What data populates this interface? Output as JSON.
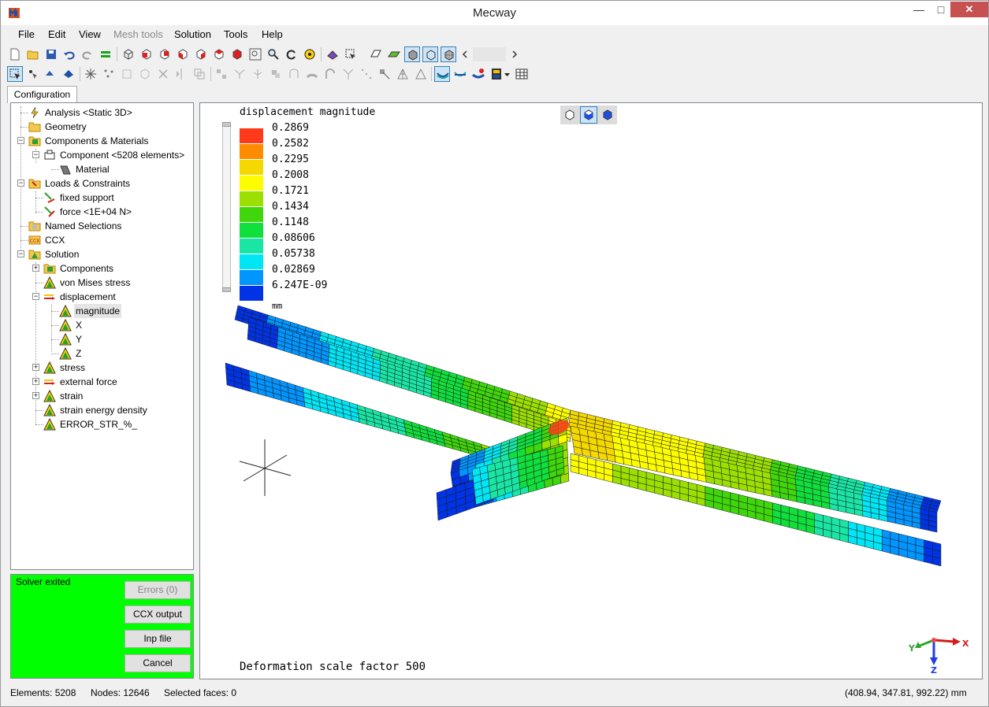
{
  "window": {
    "title": "Mecway"
  },
  "menu": [
    {
      "label": "File",
      "enabled": true
    },
    {
      "label": "Edit",
      "enabled": true
    },
    {
      "label": "View",
      "enabled": true
    },
    {
      "label": "Mesh tools",
      "enabled": false
    },
    {
      "label": "Solution",
      "enabled": true
    },
    {
      "label": "Tools",
      "enabled": true
    },
    {
      "label": "Help",
      "enabled": true
    }
  ],
  "tabs": [
    {
      "label": "Configuration",
      "active": true
    }
  ],
  "tree": {
    "analysis": "Analysis <Static 3D>",
    "geometry": "Geometry",
    "components_materials": "Components & Materials",
    "component": "Component <5208 elements>",
    "material": "Material",
    "loads_constraints": "Loads & Constraints",
    "fixed_support": "fixed support",
    "force": "force <1E+04 N>",
    "named_selections": "Named Selections",
    "ccx": "CCX",
    "solution": "Solution",
    "sol_components": "Components",
    "von_mises": "von Mises stress",
    "displacement": "displacement",
    "magnitude": "magnitude",
    "x": "X",
    "y": "Y",
    "z": "Z",
    "stress": "stress",
    "external_force": "external force",
    "strain": "strain",
    "strain_energy": "strain energy density",
    "error_str": "ERROR_STR_%_",
    "ccx_icon_text": "CCX"
  },
  "solver": {
    "status": "Solver exited",
    "errors_button": "Errors (0)",
    "ccx_output_button": "CCX output",
    "inp_file_button": "Inp file",
    "cancel_button": "Cancel"
  },
  "legend": {
    "title": "displacement magnitude",
    "unit": "mm",
    "values": [
      "0.2869",
      "0.2582",
      "0.2295",
      "0.2008",
      "0.1721",
      "0.1434",
      "0.1148",
      "0.08606",
      "0.05738",
      "0.02869",
      "6.247E-09"
    ],
    "colors": [
      "#ff3a1a",
      "#ff8c00",
      "#f5d800",
      "#fdfd00",
      "#9be000",
      "#3fd70c",
      "#10df3c",
      "#19e6a5",
      "#00e6f5",
      "#0095ff",
      "#0033e6"
    ]
  },
  "viewport": {
    "deformation_text": "Deformation scale factor 500",
    "axis_labels": {
      "x": "X",
      "y": "Y",
      "z": "Z"
    }
  },
  "status": {
    "elements": "Elements: 5208",
    "nodes": "Nodes: 12646",
    "selected": "Selected faces: 0",
    "coords": "(408.94, 347.81, 992.22) mm"
  }
}
